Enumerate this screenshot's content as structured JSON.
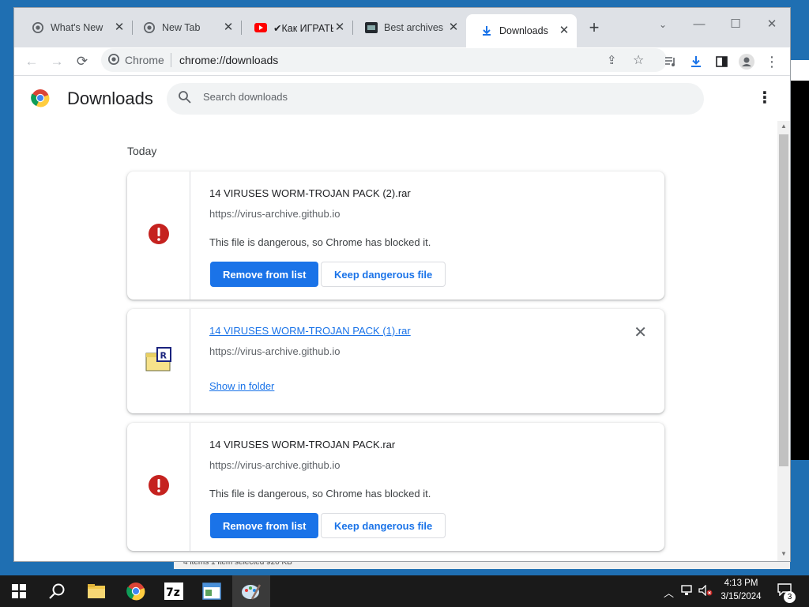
{
  "browser": {
    "tabs": [
      {
        "title": "What's New",
        "icon": "chrome-icon",
        "active": false
      },
      {
        "title": "New Tab",
        "icon": "chrome-icon",
        "active": false
      },
      {
        "title": "✔Как ИГРАТЬ",
        "icon": "youtube-icon",
        "active": false
      },
      {
        "title": "Best archives",
        "icon": "github-icon",
        "active": false
      },
      {
        "title": "Downloads",
        "icon": "download-icon",
        "active": true
      }
    ],
    "newtab_symbol": "+",
    "omnibox": {
      "site_label": "Chrome",
      "url": "chrome://downloads"
    }
  },
  "downloads_page": {
    "title": "Downloads",
    "search_placeholder": "Search downloads",
    "section_label": "Today",
    "items": [
      {
        "filename": "14 VIRUSES WORM-TROJAN PACK (2).rar",
        "source": "https://virus-archive.github.io",
        "status": "This file is dangerous, so Chrome has blocked it.",
        "primary_action": "Remove from list",
        "secondary_action": "Keep dangerous file",
        "state": "blocked"
      },
      {
        "filename": "14 VIRUSES WORM-TROJAN PACK (1).rar",
        "source": "https://virus-archive.github.io",
        "link_action": "Show in folder",
        "state": "completed"
      },
      {
        "filename": "14 VIRUSES WORM-TROJAN PACK.rar",
        "source": "https://virus-archive.github.io",
        "status": "This file is dangerous, so Chrome has blocked it.",
        "primary_action": "Remove from list",
        "secondary_action": "Keep dangerous file",
        "state": "blocked"
      }
    ]
  },
  "background_window": {
    "status_text": "4 items     1 item selected  920 KB"
  },
  "taskbar": {
    "pinned": [
      "start-icon",
      "search-icon",
      "file-explorer-icon",
      "chrome-icon",
      "7zip-icon",
      "notepad-icon",
      "paint-icon"
    ],
    "clock_time": "4:13 PM",
    "clock_date": "3/15/2024",
    "notification_count": "3"
  },
  "colors": {
    "accent": "#1a73e8",
    "danger": "#c5221f",
    "taskbar": "#1a1a1a"
  }
}
